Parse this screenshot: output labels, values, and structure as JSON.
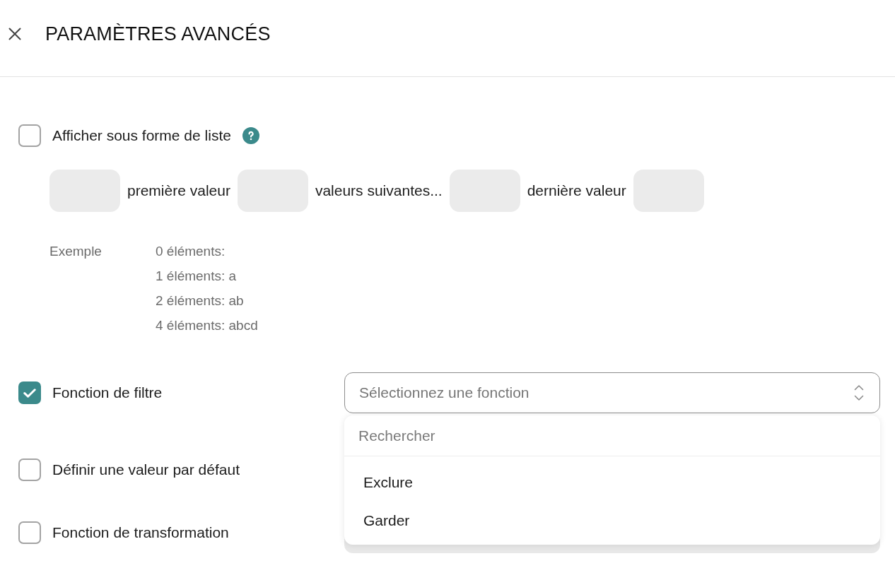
{
  "header": {
    "title": "PARAMÈTRES AVANCÉS"
  },
  "options": [
    {
      "kind": "list_format",
      "label": "Afficher sous forme de liste",
      "checked": false,
      "help": true,
      "format": {
        "parts": [
          {
            "kind": "input"
          },
          {
            "kind": "text",
            "text": "première valeur"
          },
          {
            "kind": "input"
          },
          {
            "kind": "text",
            "text": "valeurs suivantes..."
          },
          {
            "kind": "input"
          },
          {
            "kind": "text",
            "text": "dernière valeur"
          },
          {
            "kind": "input"
          }
        ]
      },
      "example": {
        "label": "Exemple",
        "lines": [
          "0 éléments:",
          "1 éléments: a",
          "2 éléments: ab",
          "4 éléments: abcd"
        ]
      }
    },
    {
      "kind": "function_select",
      "label": "Fonction de filtre",
      "checked": true,
      "help": false,
      "select": {
        "placeholder": "Sélectionnez une fonction",
        "expanded": true,
        "search_placeholder": "Rechercher",
        "items": [
          {
            "label": "Exclure",
            "selected": false
          },
          {
            "label": "Garder",
            "selected": false
          }
        ]
      }
    },
    {
      "kind": "plain",
      "label": "Définir une valeur par défaut",
      "checked": false,
      "help": false
    },
    {
      "kind": "plain",
      "label": "Fonction de transformation",
      "checked": false,
      "help": false
    }
  ]
}
